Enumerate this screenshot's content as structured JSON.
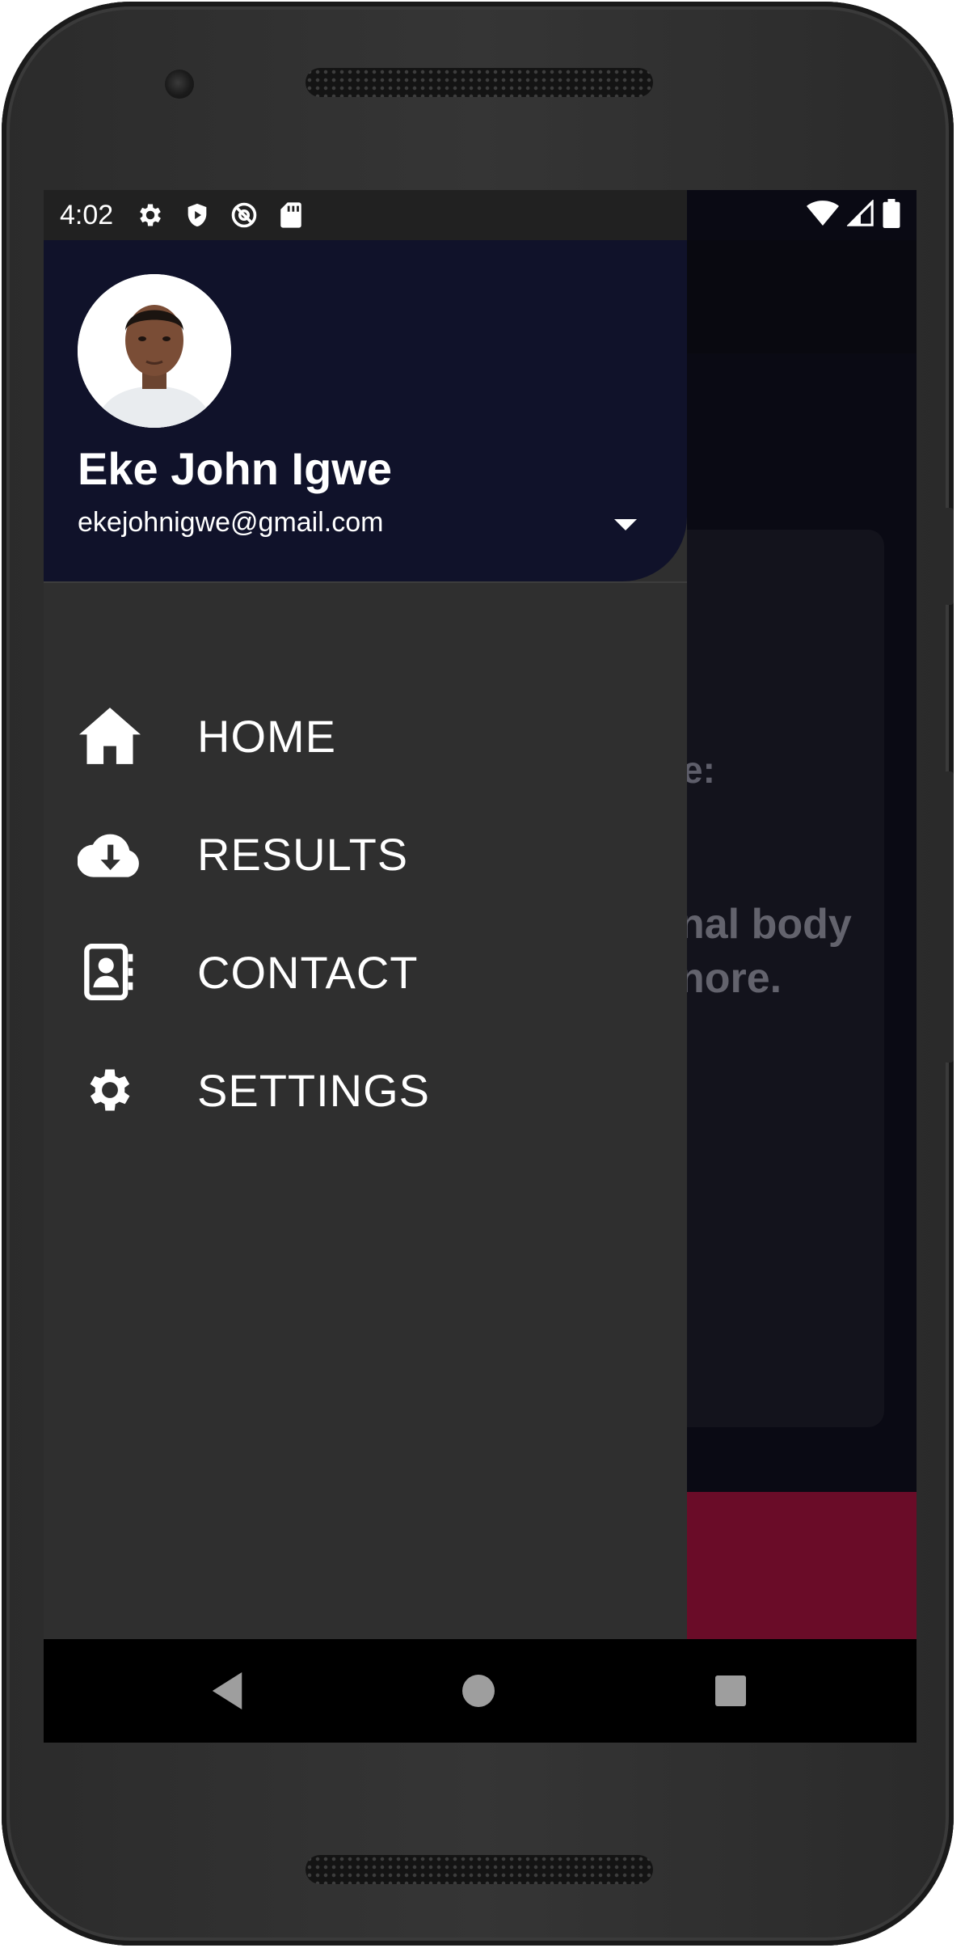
{
  "status_bar": {
    "time": "4:02",
    "left_icons": [
      "gear-icon",
      "shield-play-icon",
      "at-sign-icon",
      "sd-card-icon"
    ],
    "right_icons": [
      "wifi-icon",
      "signal-icon",
      "battery-icon"
    ]
  },
  "drawer": {
    "header": {
      "user_name": "Eke John Igwe",
      "email": "ekejohnigwe@gmail.com",
      "toggle_icon": "dropdown-arrow-icon"
    },
    "items": [
      {
        "label": "HOME",
        "icon": "home-icon"
      },
      {
        "label": "RESULTS",
        "icon": "cloud-download-icon"
      },
      {
        "label": "CONTACT",
        "icon": "contact-book-icon"
      },
      {
        "label": "SETTINGS",
        "icon": "gear-icon"
      }
    ]
  },
  "background": {
    "line1": "e:",
    "line2": "nal body",
    "line3": "nore."
  },
  "colors": {
    "drawer_header": "#10122a",
    "drawer_body": "#2f2f2f",
    "bottom_bar": "#6a0c28"
  }
}
